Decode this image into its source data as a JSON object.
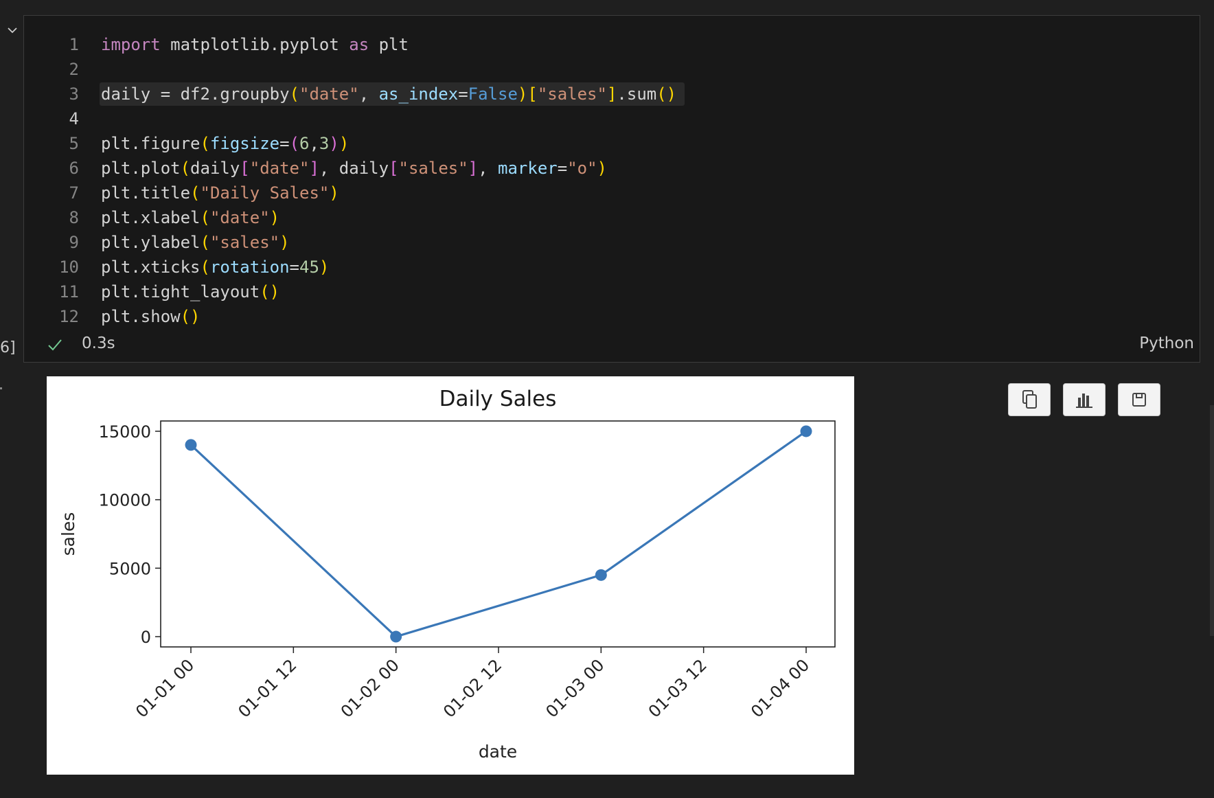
{
  "cell": {
    "execution_count": "6]",
    "exec_time": "0.3s",
    "language": "Python",
    "lines": [
      {
        "n": "1",
        "tokens": [
          [
            "kw",
            "import"
          ],
          [
            "t",
            " matplotlib.pyplot "
          ],
          [
            "kw",
            "as"
          ],
          [
            "t",
            " plt"
          ]
        ]
      },
      {
        "n": "2",
        "tokens": []
      },
      {
        "n": "3",
        "highlight": true,
        "tokens": [
          [
            "t",
            "daily = df2.groupby"
          ],
          [
            "p1",
            "("
          ],
          [
            "str",
            "\"date\""
          ],
          [
            "t",
            ", "
          ],
          [
            "param",
            "as_index"
          ],
          [
            "t",
            "="
          ],
          [
            "const",
            "False"
          ],
          [
            "p1",
            ")"
          ],
          [
            "p1",
            "["
          ],
          [
            "str",
            "\"sales\""
          ],
          [
            "p1",
            "]"
          ],
          [
            "t",
            ".sum"
          ],
          [
            "p1",
            "()"
          ]
        ]
      },
      {
        "n": "4",
        "active": true,
        "tokens": []
      },
      {
        "n": "5",
        "tokens": [
          [
            "t",
            "plt.figure"
          ],
          [
            "p1",
            "("
          ],
          [
            "param",
            "figsize"
          ],
          [
            "t",
            "="
          ],
          [
            "p2",
            "("
          ],
          [
            "num",
            "6"
          ],
          [
            "t",
            ","
          ],
          [
            "num",
            "3"
          ],
          [
            "p2",
            ")"
          ],
          [
            "p1",
            ")"
          ]
        ]
      },
      {
        "n": "6",
        "tokens": [
          [
            "t",
            "plt.plot"
          ],
          [
            "p1",
            "("
          ],
          [
            "t",
            "daily"
          ],
          [
            "p2",
            "["
          ],
          [
            "str",
            "\"date\""
          ],
          [
            "p2",
            "]"
          ],
          [
            "t",
            ", daily"
          ],
          [
            "p2",
            "["
          ],
          [
            "str",
            "\"sales\""
          ],
          [
            "p2",
            "]"
          ],
          [
            "t",
            ", "
          ],
          [
            "param",
            "marker"
          ],
          [
            "t",
            "="
          ],
          [
            "str",
            "\"o\""
          ],
          [
            "p1",
            ")"
          ]
        ]
      },
      {
        "n": "7",
        "tokens": [
          [
            "t",
            "plt.title"
          ],
          [
            "p1",
            "("
          ],
          [
            "str",
            "\"Daily Sales\""
          ],
          [
            "p1",
            ")"
          ]
        ]
      },
      {
        "n": "8",
        "tokens": [
          [
            "t",
            "plt.xlabel"
          ],
          [
            "p1",
            "("
          ],
          [
            "str",
            "\"date\""
          ],
          [
            "p1",
            ")"
          ]
        ]
      },
      {
        "n": "9",
        "tokens": [
          [
            "t",
            "plt.ylabel"
          ],
          [
            "p1",
            "("
          ],
          [
            "str",
            "\"sales\""
          ],
          [
            "p1",
            ")"
          ]
        ]
      },
      {
        "n": "10",
        "tokens": [
          [
            "t",
            "plt.xticks"
          ],
          [
            "p1",
            "("
          ],
          [
            "param",
            "rotation"
          ],
          [
            "t",
            "="
          ],
          [
            "num",
            "45"
          ],
          [
            "p1",
            ")"
          ]
        ]
      },
      {
        "n": "11",
        "tokens": [
          [
            "t",
            "plt.tight_layout"
          ],
          [
            "p1",
            "()"
          ]
        ]
      },
      {
        "n": "12",
        "tokens": [
          [
            "t",
            "plt.show"
          ],
          [
            "p1",
            "()"
          ]
        ]
      }
    ]
  },
  "output_toolbar": {
    "copy_icon": "copy-icon",
    "chart_icon": "bar-chart-icon",
    "save_icon": "save-icon"
  },
  "chart_data": {
    "type": "line",
    "title": "Daily Sales",
    "xlabel": "date",
    "ylabel": "sales",
    "x": [
      "01-01 00",
      "01-02 00",
      "01-03 00",
      "01-04 00"
    ],
    "series": [
      {
        "values": [
          14000,
          0,
          4500,
          15000
        ],
        "color": "#3a77b7",
        "marker": "o"
      }
    ],
    "x_ticks": [
      "01-01 00",
      "01-01 12",
      "01-02 00",
      "01-02 12",
      "01-03 00",
      "01-03 12",
      "01-04 00"
    ],
    "y_ticks": [
      0,
      5000,
      10000,
      15000
    ],
    "ylim": [
      -750,
      15750
    ],
    "grid": false
  }
}
